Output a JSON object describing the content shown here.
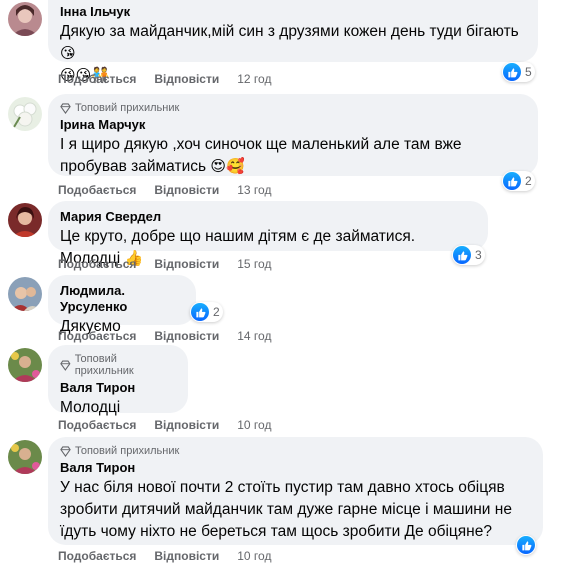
{
  "labels": {
    "like": "Подобається",
    "reply": "Відповісти",
    "top_fan": "Топовий прихильник"
  },
  "comments": [
    {
      "author": "Інна Ільчук",
      "text1": "Дякую за майданчик,мій син з друзями кожен день туди бігають",
      "text2": "",
      "time": "12 год",
      "reactions": "5",
      "emoji": "😘",
      "emoji2": "😘😘🧑‍🤝‍🧑"
    },
    {
      "author": "Ірина Марчук",
      "text1": "І я щиро дякую ,хоч синочок ще маленький але там вже пробував займатись",
      "time": "13 год",
      "reactions": "2",
      "emoji": "😍🥰"
    },
    {
      "author": "Мария Свердел",
      "text1": "Це круто, добре що нашим дітям є де займатися. Молодці",
      "time": "15 год",
      "reactions": "3",
      "emoji": "👍"
    },
    {
      "author": "Людмила. Урсуленко",
      "text1": "Дякуємо",
      "time": "14 год",
      "reactions": "2"
    },
    {
      "author": "Валя Тирон",
      "text1": "Молодці",
      "time": "10 год"
    },
    {
      "author": "Валя Тирон",
      "text1": "У нас біля нової почти 2 стоїть пустир там давно хтось обіцяв зробити дитячий майданчик там дуже гарне місце і машини не їдуть чому ніхто не береться там щось зробити Де обіцяне?",
      "time": "10 год"
    }
  ],
  "colors": {
    "bubble": "#f0f2f5",
    "meta": "#65676b",
    "like_blue": "#0866ff"
  }
}
